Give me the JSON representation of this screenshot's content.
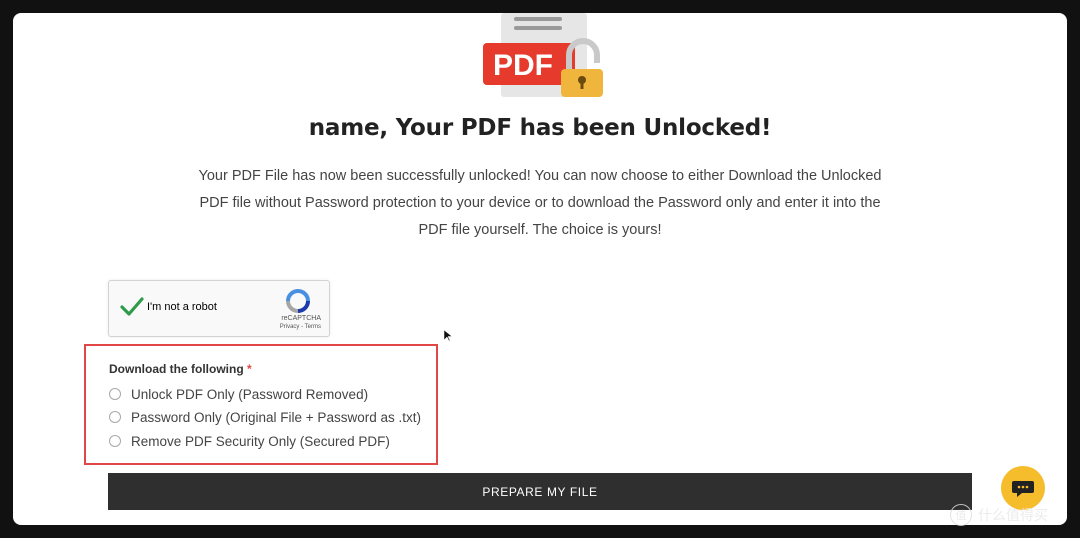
{
  "pdf_graphic": {
    "badge_text": "PDF",
    "badge_color": "#e53a2c",
    "lock_color": "#f0b53c"
  },
  "headline": "name, Your PDF has been Unlocked!",
  "description": "Your PDF File has now been successfully unlocked! You can now choose to either Download the Unlocked PDF file without Password protection to your device or to download the Password only and enter it into the PDF file yourself. The choice is yours!",
  "recaptcha": {
    "label": "I'm not a robot",
    "brand": "reCAPTCHA",
    "terms": "Privacy - Terms",
    "checked": true
  },
  "download_form": {
    "title": "Download the following",
    "required_mark": "*",
    "options": [
      "Unlock PDF Only (Password Removed)",
      "Password Only (Original File + Password as .txt)",
      "Remove PDF Security Only (Secured PDF)"
    ],
    "highlight_color": "#e14747"
  },
  "prepare_button": "PREPARE MY FILE",
  "chat_button": {
    "icon": "chat-bubble-icon",
    "color": "#f5bc2c"
  },
  "watermark": {
    "badge": "值",
    "text": "什么值得买"
  }
}
